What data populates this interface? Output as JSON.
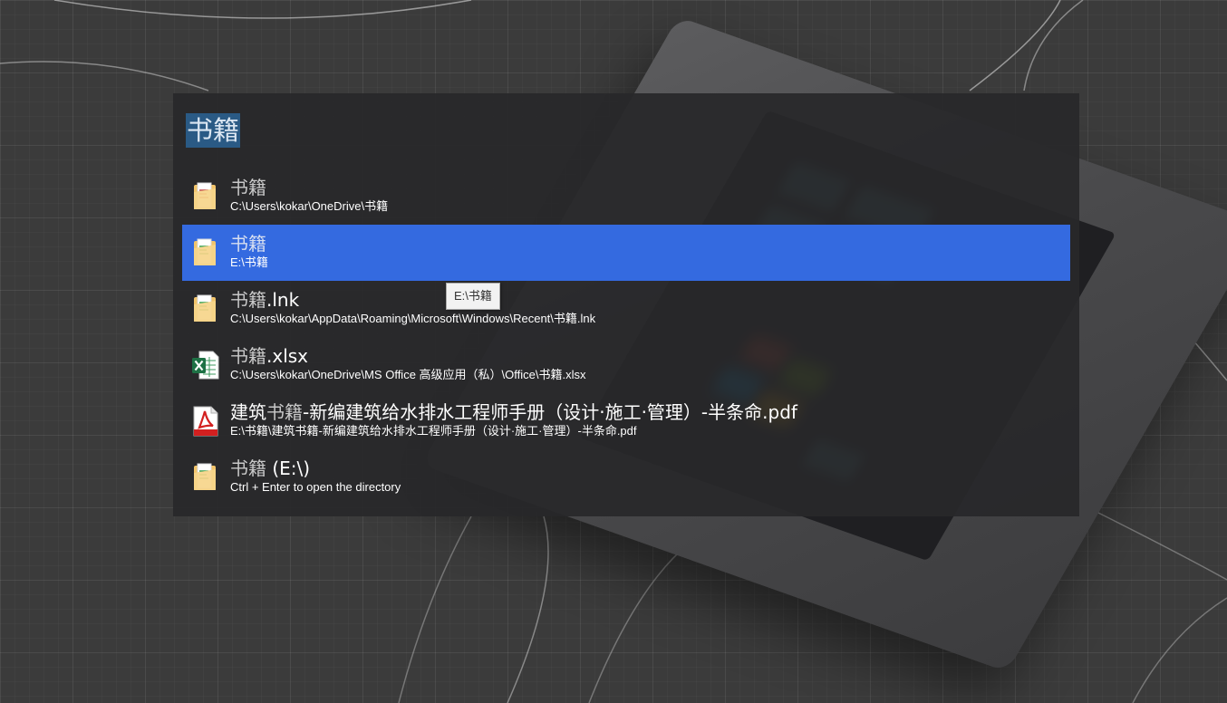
{
  "query": {
    "text": "书籍"
  },
  "results": [
    {
      "title_highlight": "书籍",
      "title_rest": "",
      "subtitle": "C:\\Users\\kokar\\OneDrive\\书籍",
      "icon": "folder-icon",
      "selected": false
    },
    {
      "title_highlight": "书籍",
      "title_rest": "",
      "subtitle": "E:\\书籍",
      "icon": "folder-icon",
      "selected": true
    },
    {
      "title_highlight": "书籍",
      "title_rest": ".lnk",
      "subtitle": "C:\\Users\\kokar\\AppData\\Roaming\\Microsoft\\Windows\\Recent\\书籍.lnk",
      "icon": "folder-shortcut-icon",
      "selected": false
    },
    {
      "title_highlight": "书籍",
      "title_rest": ".xlsx",
      "subtitle": "C:\\Users\\kokar\\OneDrive\\MS Office 高级应用（私）\\Office\\书籍.xlsx",
      "icon": "excel-icon",
      "selected": false
    },
    {
      "title_prefix": "建筑",
      "title_highlight": "书籍",
      "title_rest": "-新编建筑给水排水工程师手册（设计·施工·管理）-半条命.pdf",
      "subtitle": "E:\\书籍\\建筑书籍-新编建筑给水排水工程师手册（设计·施工·管理）-半条命.pdf",
      "icon": "pdf-icon",
      "selected": false
    },
    {
      "title_highlight": "书籍",
      "title_rest": " (E:\\)",
      "subtitle": "Ctrl + Enter to open the directory",
      "icon": "folder-icon",
      "selected": false
    }
  ],
  "tooltip": {
    "text": "E:\\书籍"
  },
  "colors": {
    "selected_row": "#346ae0",
    "query_selection": "#2a5a85",
    "launcher_bg": "#28282a"
  }
}
